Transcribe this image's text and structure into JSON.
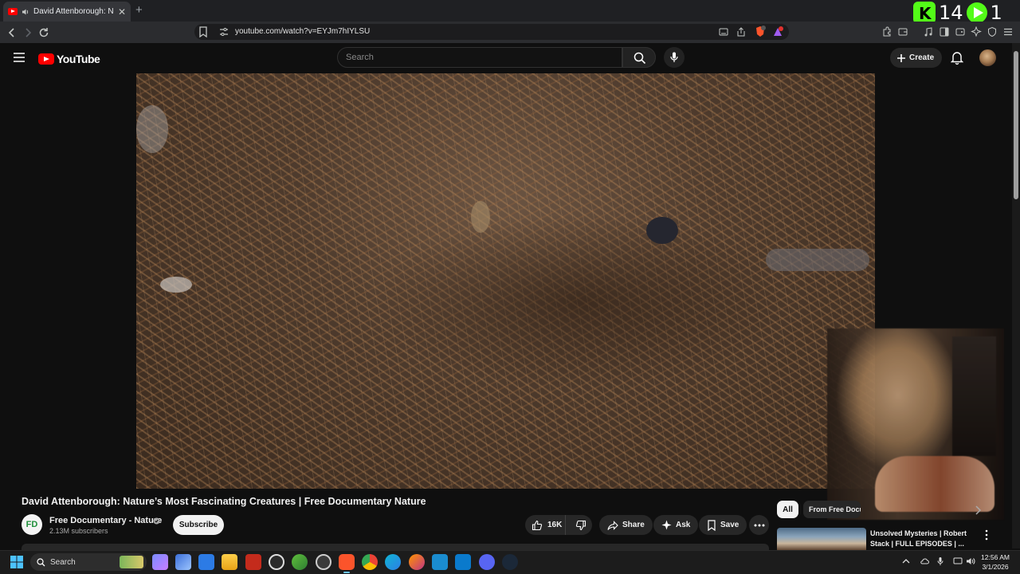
{
  "browser": {
    "tab_title": "David Attenborough: Nature's Most Fascinating Creatures | Free Documentary Nature",
    "url": "youtube.com/watch?v=EYJm7hIYLSU",
    "new_tab_label": "+",
    "close_label": "✕"
  },
  "stream_overlay": {
    "count_left": "14",
    "count_right": "1"
  },
  "youtube": {
    "logo_text": "YouTube",
    "search_placeholder": "Search",
    "create_label": "Create"
  },
  "video": {
    "title": "David Attenborough: Nature’s Most Fascinating Creatures | Free Documentary Nature",
    "channel_initials": "FD",
    "channel_name": "Free Documentary - Nature",
    "subscribers": "2.13M subscribers",
    "subscribe_label": "Subscribe",
    "likes": "16K",
    "share_label": "Share",
    "ask_label": "Ask",
    "save_label": "Save"
  },
  "sidebar": {
    "chips": [
      "All",
      "From Free Documentary"
    ],
    "recommendation": {
      "title": "Unsolved Mysteries | Robert Stack | FULL EPISODES | ..."
    }
  },
  "taskbar": {
    "search_label": "Search",
    "time": "12:56 AM",
    "date": "3/1/2026"
  }
}
